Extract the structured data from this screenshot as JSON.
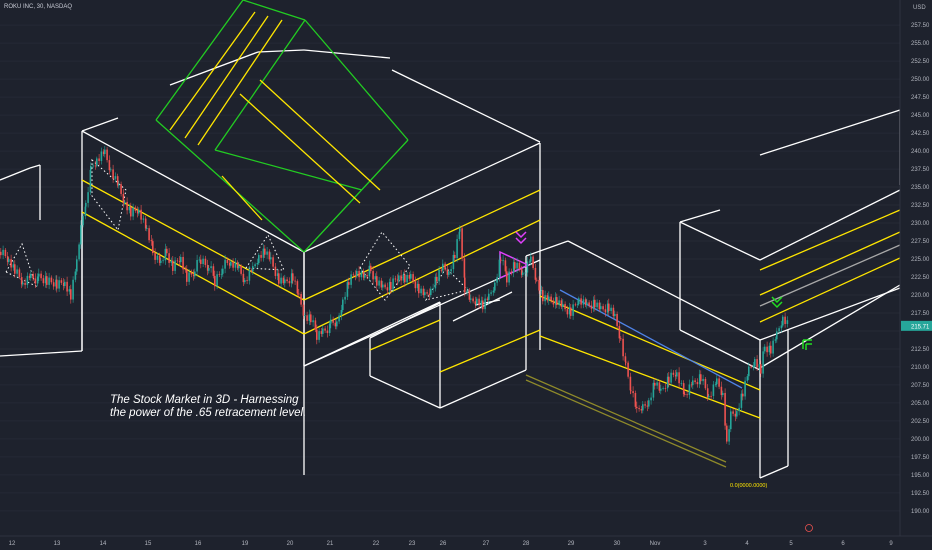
{
  "header": {
    "symbol": "ROKU INC, 30, NASDAQ"
  },
  "annotation": {
    "text": "The Stock Market in 3D - Harnessing the power of the .65 retracement level."
  },
  "chart_data": {
    "type": "candlestick",
    "currency": "USD",
    "ylim": [
      186.5,
      261.0
    ],
    "y_ticks": [
      "190.00",
      "192.50",
      "195.00",
      "197.50",
      "200.00",
      "202.50",
      "205.00",
      "207.50",
      "210.00",
      "212.50",
      "217.50",
      "220.00",
      "222.50",
      "225.00",
      "227.50",
      "230.00",
      "232.50",
      "235.00",
      "237.50",
      "240.00",
      "242.50",
      "245.00",
      "247.50",
      "250.00",
      "252.50",
      "255.00",
      "257.50"
    ],
    "last_price": "215.71",
    "x_ticks": [
      "12",
      "13",
      "14",
      "15",
      "16",
      "19",
      "20",
      "21",
      "22",
      "23",
      "26",
      "27",
      "28",
      "29",
      "30",
      "Nov",
      "3",
      "4",
      "5",
      "6",
      "9"
    ],
    "fib_label": "0.0(0000.0000)",
    "colors": {
      "background": "#1e222d",
      "up_candle": "#26a69a",
      "down_candle": "#ef5350",
      "box_lines": "#ffffff",
      "channel_lines": "#ffe600",
      "green_box": "#22cc22",
      "trendline": "#4f83e6",
      "pattern_marker": "#e040fb",
      "last_price_badge": "#26a69a"
    },
    "price_path": [
      [
        0,
        226.0
      ],
      [
        8,
        225.0
      ],
      [
        14,
        223.5
      ],
      [
        22,
        221.8
      ],
      [
        30,
        222.6
      ],
      [
        38,
        222.2
      ],
      [
        46,
        221.8
      ],
      [
        56,
        221.5
      ],
      [
        64,
        222.0
      ],
      [
        70,
        220.0
      ],
      [
        76,
        224.5
      ],
      [
        80,
        229.0
      ],
      [
        85,
        233.0
      ],
      [
        90,
        237.5
      ],
      [
        96,
        239.0
      ],
      [
        104,
        239.8
      ],
      [
        110,
        237.5
      ],
      [
        118,
        235.0
      ],
      [
        124,
        233.0
      ],
      [
        130,
        231.5
      ],
      [
        138,
        232.0
      ],
      [
        146,
        229.0
      ],
      [
        152,
        226.0
      ],
      [
        160,
        224.5
      ],
      [
        166,
        226.0
      ],
      [
        172,
        224.0
      ],
      [
        180,
        225.5
      ],
      [
        186,
        222.5
      ],
      [
        194,
        223.5
      ],
      [
        200,
        225.0
      ],
      [
        208,
        224.0
      ],
      [
        214,
        222.0
      ],
      [
        222,
        224.0
      ],
      [
        230,
        224.5
      ],
      [
        238,
        223.5
      ],
      [
        244,
        222.0
      ],
      [
        252,
        223.5
      ],
      [
        258,
        225.5
      ],
      [
        264,
        226.0
      ],
      [
        270,
        224.5
      ],
      [
        278,
        222.0
      ],
      [
        284,
        221.5
      ],
      [
        292,
        222.5
      ],
      [
        298,
        219.5
      ],
      [
        304,
        217.0
      ],
      [
        310,
        216.5
      ],
      [
        316,
        214.5
      ],
      [
        322,
        215.0
      ],
      [
        330,
        215.8
      ],
      [
        336,
        216.0
      ],
      [
        342,
        219.5
      ],
      [
        348,
        222.0
      ],
      [
        356,
        223.5
      ],
      [
        364,
        222.5
      ],
      [
        370,
        223.5
      ],
      [
        376,
        222.0
      ],
      [
        382,
        221.0
      ],
      [
        390,
        221.5
      ],
      [
        398,
        223.0
      ],
      [
        404,
        222.5
      ],
      [
        410,
        222.5
      ],
      [
        418,
        221.0
      ],
      [
        424,
        220.0
      ],
      [
        430,
        221.0
      ],
      [
        436,
        222.5
      ],
      [
        442,
        223.8
      ],
      [
        448,
        223.2
      ],
      [
        454,
        225.5
      ],
      [
        459,
        229.0
      ],
      [
        464,
        221.0
      ],
      [
        470,
        219.0
      ],
      [
        476,
        219.5
      ],
      [
        482,
        218.5
      ],
      [
        488,
        219.5
      ],
      [
        494,
        221.5
      ],
      [
        500,
        225.0
      ],
      [
        506,
        222.5
      ],
      [
        514,
        224.0
      ],
      [
        522,
        223.0
      ],
      [
        530,
        224.8
      ],
      [
        536,
        222.0
      ],
      [
        542,
        219.5
      ],
      [
        548,
        219.0
      ],
      [
        556,
        219.0
      ],
      [
        562,
        218.0
      ],
      [
        570,
        217.5
      ],
      [
        578,
        219.5
      ],
      [
        586,
        218.5
      ],
      [
        594,
        219.0
      ],
      [
        600,
        218.0
      ],
      [
        608,
        218.5
      ],
      [
        614,
        217.0
      ],
      [
        620,
        214.0
      ],
      [
        625,
        210.0
      ],
      [
        630,
        207.0
      ],
      [
        636,
        203.5
      ],
      [
        642,
        204.5
      ],
      [
        648,
        205.5
      ],
      [
        654,
        208.0
      ],
      [
        660,
        206.5
      ],
      [
        668,
        208.5
      ],
      [
        676,
        209.5
      ],
      [
        684,
        206.0
      ],
      [
        692,
        207.5
      ],
      [
        700,
        208.5
      ],
      [
        708,
        206.0
      ],
      [
        716,
        208.0
      ],
      [
        722,
        206.5
      ],
      [
        726,
        199.5
      ],
      [
        730,
        203.5
      ],
      [
        736,
        204.0
      ],
      [
        742,
        206.5
      ],
      [
        748,
        209.5
      ],
      [
        754,
        211.0
      ],
      [
        760,
        209.5
      ],
      [
        764,
        213.0
      ],
      [
        770,
        212.5
      ],
      [
        776,
        214.5
      ],
      [
        782,
        217.0
      ],
      [
        788,
        215.7
      ]
    ]
  }
}
